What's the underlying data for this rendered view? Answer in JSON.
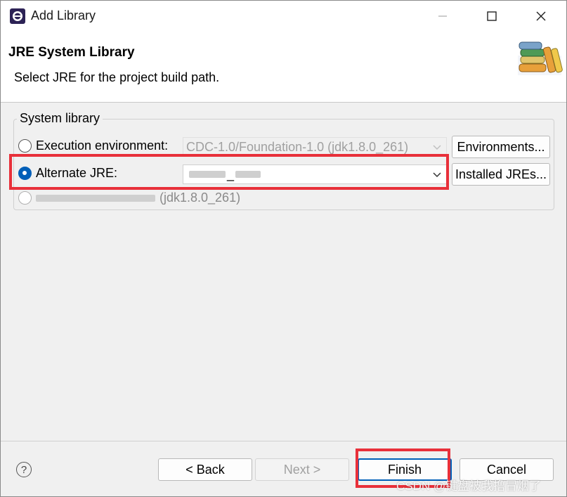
{
  "window": {
    "title": "Add Library",
    "controls": {
      "minimize": "minimize-icon",
      "maximize": "maximize-icon",
      "close": "close-icon"
    }
  },
  "banner": {
    "title": "JRE System Library",
    "description": "Select JRE for the project build path.",
    "icon": "library-books-icon"
  },
  "group": {
    "legend": "System library",
    "options": [
      {
        "label": "Execution environment:",
        "checked": false
      },
      {
        "label": "Alternate JRE:",
        "checked": true
      },
      {
        "label": "(jdk1.8.0_261)",
        "checked": false
      }
    ],
    "execution_env_value": "CDC-1.0/Foundation-1.0 (jdk1.8.0_261)",
    "alternate_jre_value": "_",
    "environments_button": "Environments...",
    "installed_jres_button": "Installed JREs..."
  },
  "footer": {
    "help_icon": "help-icon",
    "back": "< Back",
    "next": "Next >",
    "finish": "Finish",
    "cancel": "Cancel"
  },
  "watermark": "CSDN @键盘被我撸冒烟了",
  "colors": {
    "accent": "#005fb8",
    "highlight": "#e8303a"
  }
}
